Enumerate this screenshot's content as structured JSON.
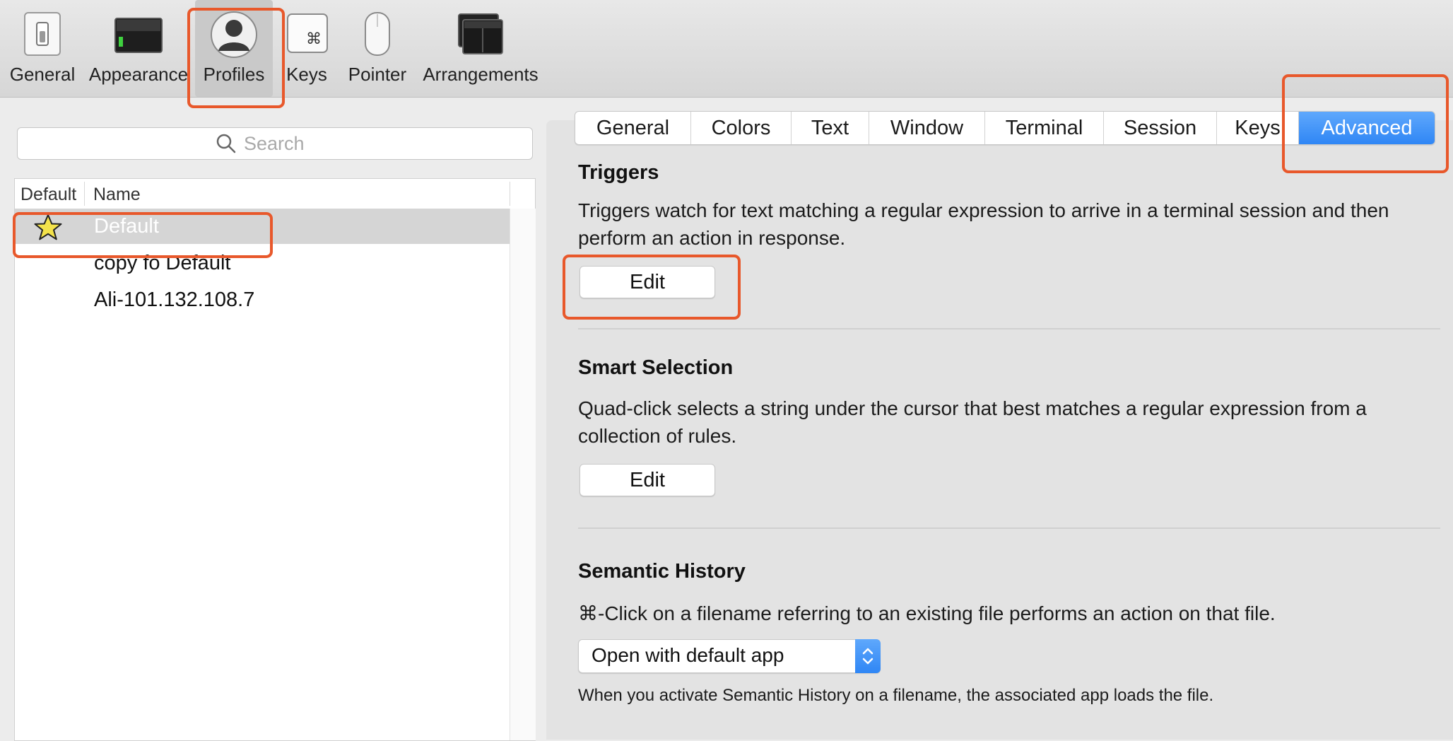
{
  "toolbar": {
    "items": [
      {
        "label": "General",
        "icon": "toggle-switch-icon"
      },
      {
        "label": "Appearance",
        "icon": "monitor-icon"
      },
      {
        "label": "Profiles",
        "icon": "user-silhouette-icon",
        "selected": true
      },
      {
        "label": "Keys",
        "icon": "command-key-icon"
      },
      {
        "label": "Pointer",
        "icon": "mouse-icon"
      },
      {
        "label": "Arrangements",
        "icon": "window-arrangement-icon"
      }
    ]
  },
  "left": {
    "search_placeholder": "Search",
    "columns": [
      "Default",
      "Name"
    ],
    "profiles": [
      {
        "name": "Default",
        "is_default": true,
        "selected": true
      },
      {
        "name": "copy fo Default"
      },
      {
        "name": "Ali-101.132.108.7"
      }
    ]
  },
  "tabs": [
    "General",
    "Colors",
    "Text",
    "Window",
    "Terminal",
    "Session",
    "Keys",
    "Advanced"
  ],
  "active_tab": "Advanced",
  "triggers": {
    "title": "Triggers",
    "description": "Triggers watch for text matching a regular expression to arrive in a terminal session and then perform an action in response.",
    "button": "Edit"
  },
  "smart_selection": {
    "title": "Smart Selection",
    "description": "Quad-click selects a string under the cursor that best matches a regular expression from a collection of rules.",
    "button": "Edit"
  },
  "semantic_history": {
    "title": "Semantic History",
    "description": "⌘-Click on a filename referring to an existing file performs an action on that file.",
    "select_value": "Open with default app",
    "note": "When you activate Semantic History on a filename, the associated app loads the file."
  },
  "colors": {
    "accent": "#2f86f5",
    "highlight_box": "#e8582b",
    "star_fill": "#f3e24b"
  }
}
